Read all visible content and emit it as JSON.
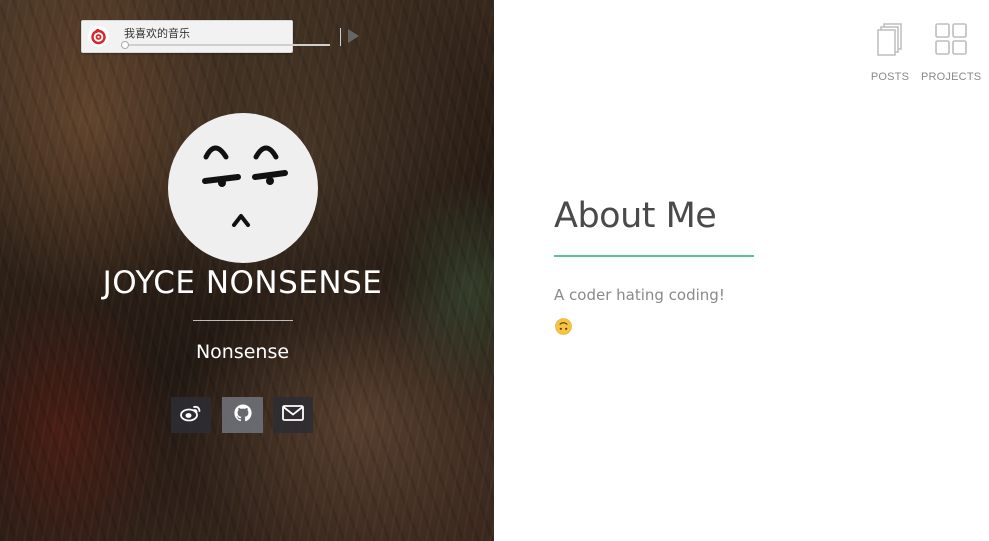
{
  "music_player": {
    "title": "我喜欢的音乐"
  },
  "profile": {
    "name": "JOYCE NONSENSE",
    "tagline": "Nonsense"
  },
  "social": [
    {
      "name": "weibo",
      "icon": "weibo-icon"
    },
    {
      "name": "github",
      "icon": "github-icon",
      "active": true
    },
    {
      "name": "mail",
      "icon": "envelope-icon"
    }
  ],
  "nav": {
    "posts_label": "POSTS",
    "projects_label": "PROJECTS"
  },
  "about": {
    "title": "About Me",
    "text": "A coder hating coding!",
    "emoji": "upside-down-face-emoji"
  },
  "colors": {
    "accent_green": "#5fc48a",
    "music_red": "#d8262b",
    "nav_gray": "#8a8a8a",
    "heading": "#4a4a4a"
  }
}
